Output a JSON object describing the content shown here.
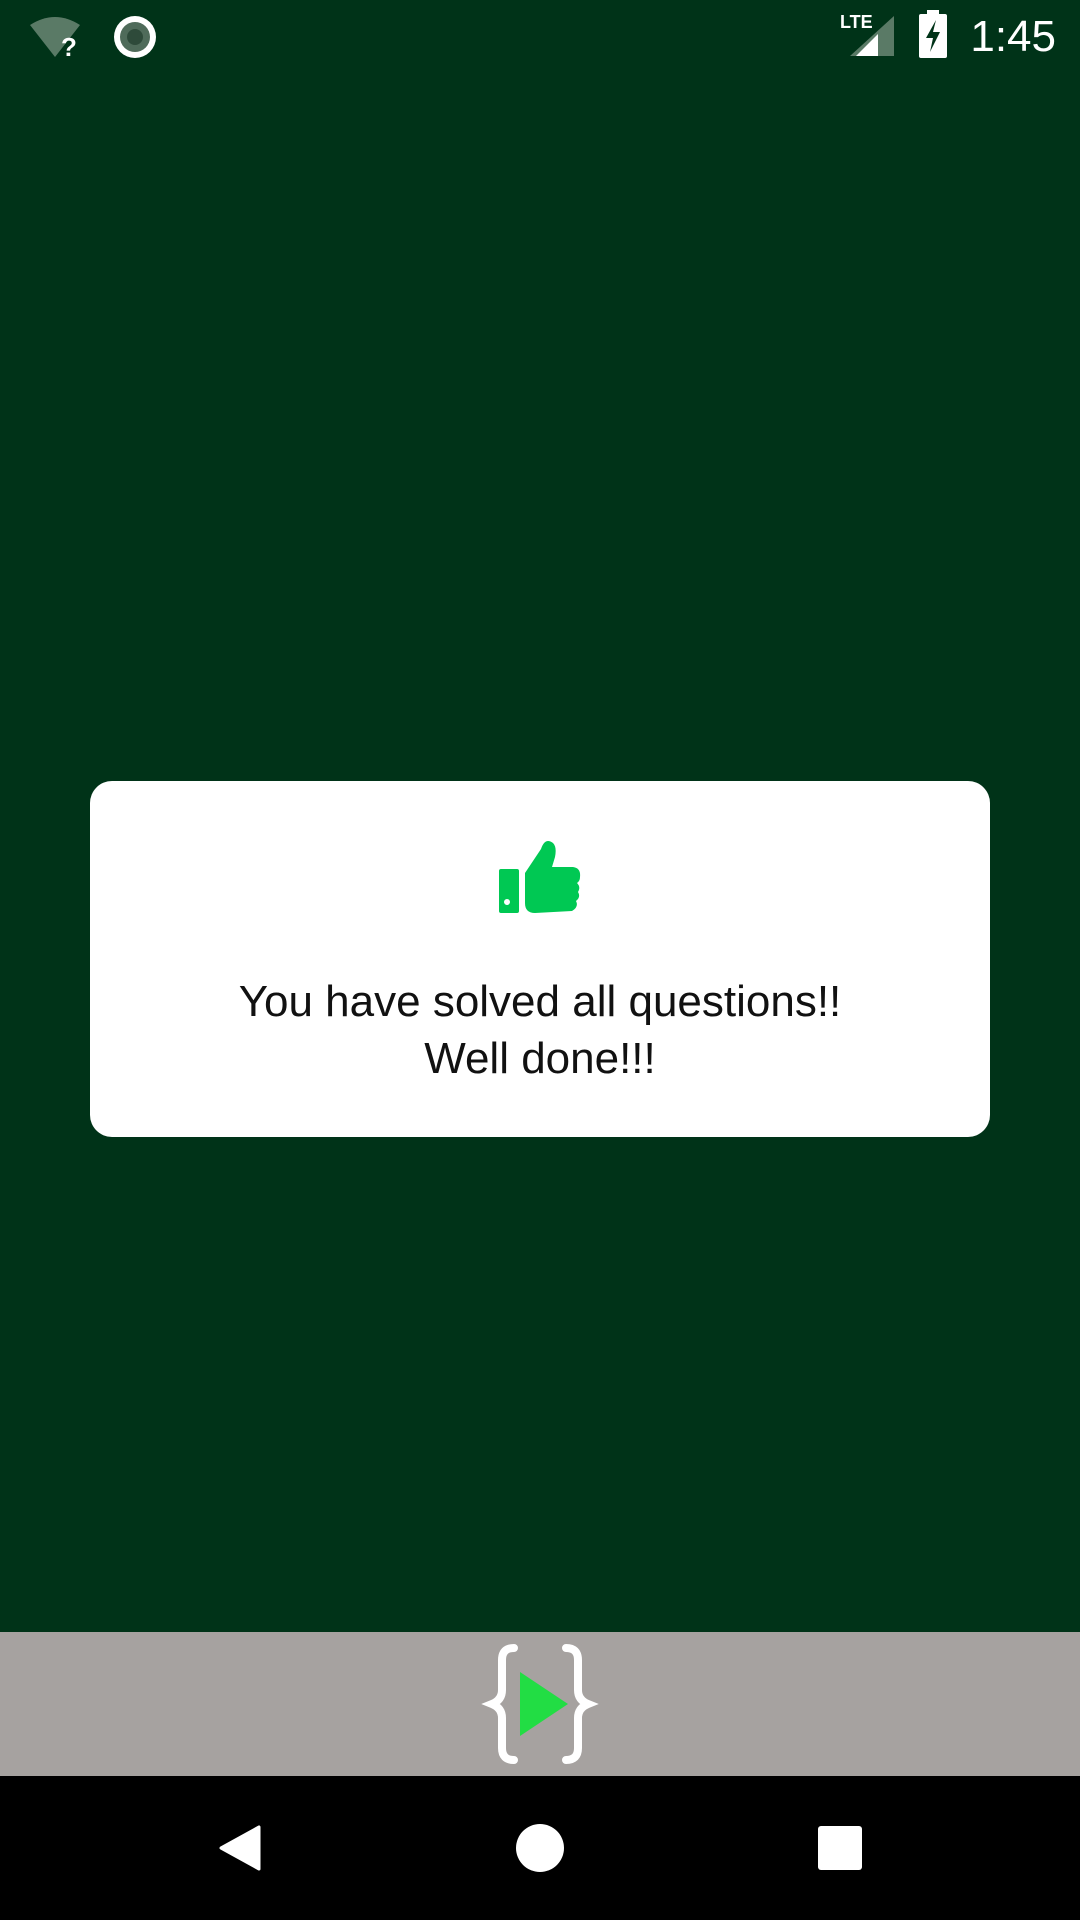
{
  "status_bar": {
    "time": "1:45",
    "network_label": "LTE",
    "icons": [
      "wifi-unknown-icon",
      "location-ring-icon",
      "lte-signal-icon",
      "battery-charging-icon"
    ]
  },
  "colors": {
    "background": "#003318",
    "dialog": "#ffffff",
    "accent": "#00c853",
    "banner": "#a6a2a0",
    "nav": "#000000"
  },
  "dialog": {
    "icon": "thumbs-up-icon",
    "message": "You have solved all questions!!\nWell done!!!"
  },
  "banner": {
    "icon": "code-play-logo-icon"
  },
  "navigation": {
    "buttons": [
      "back-icon",
      "home-icon",
      "recents-icon"
    ]
  }
}
